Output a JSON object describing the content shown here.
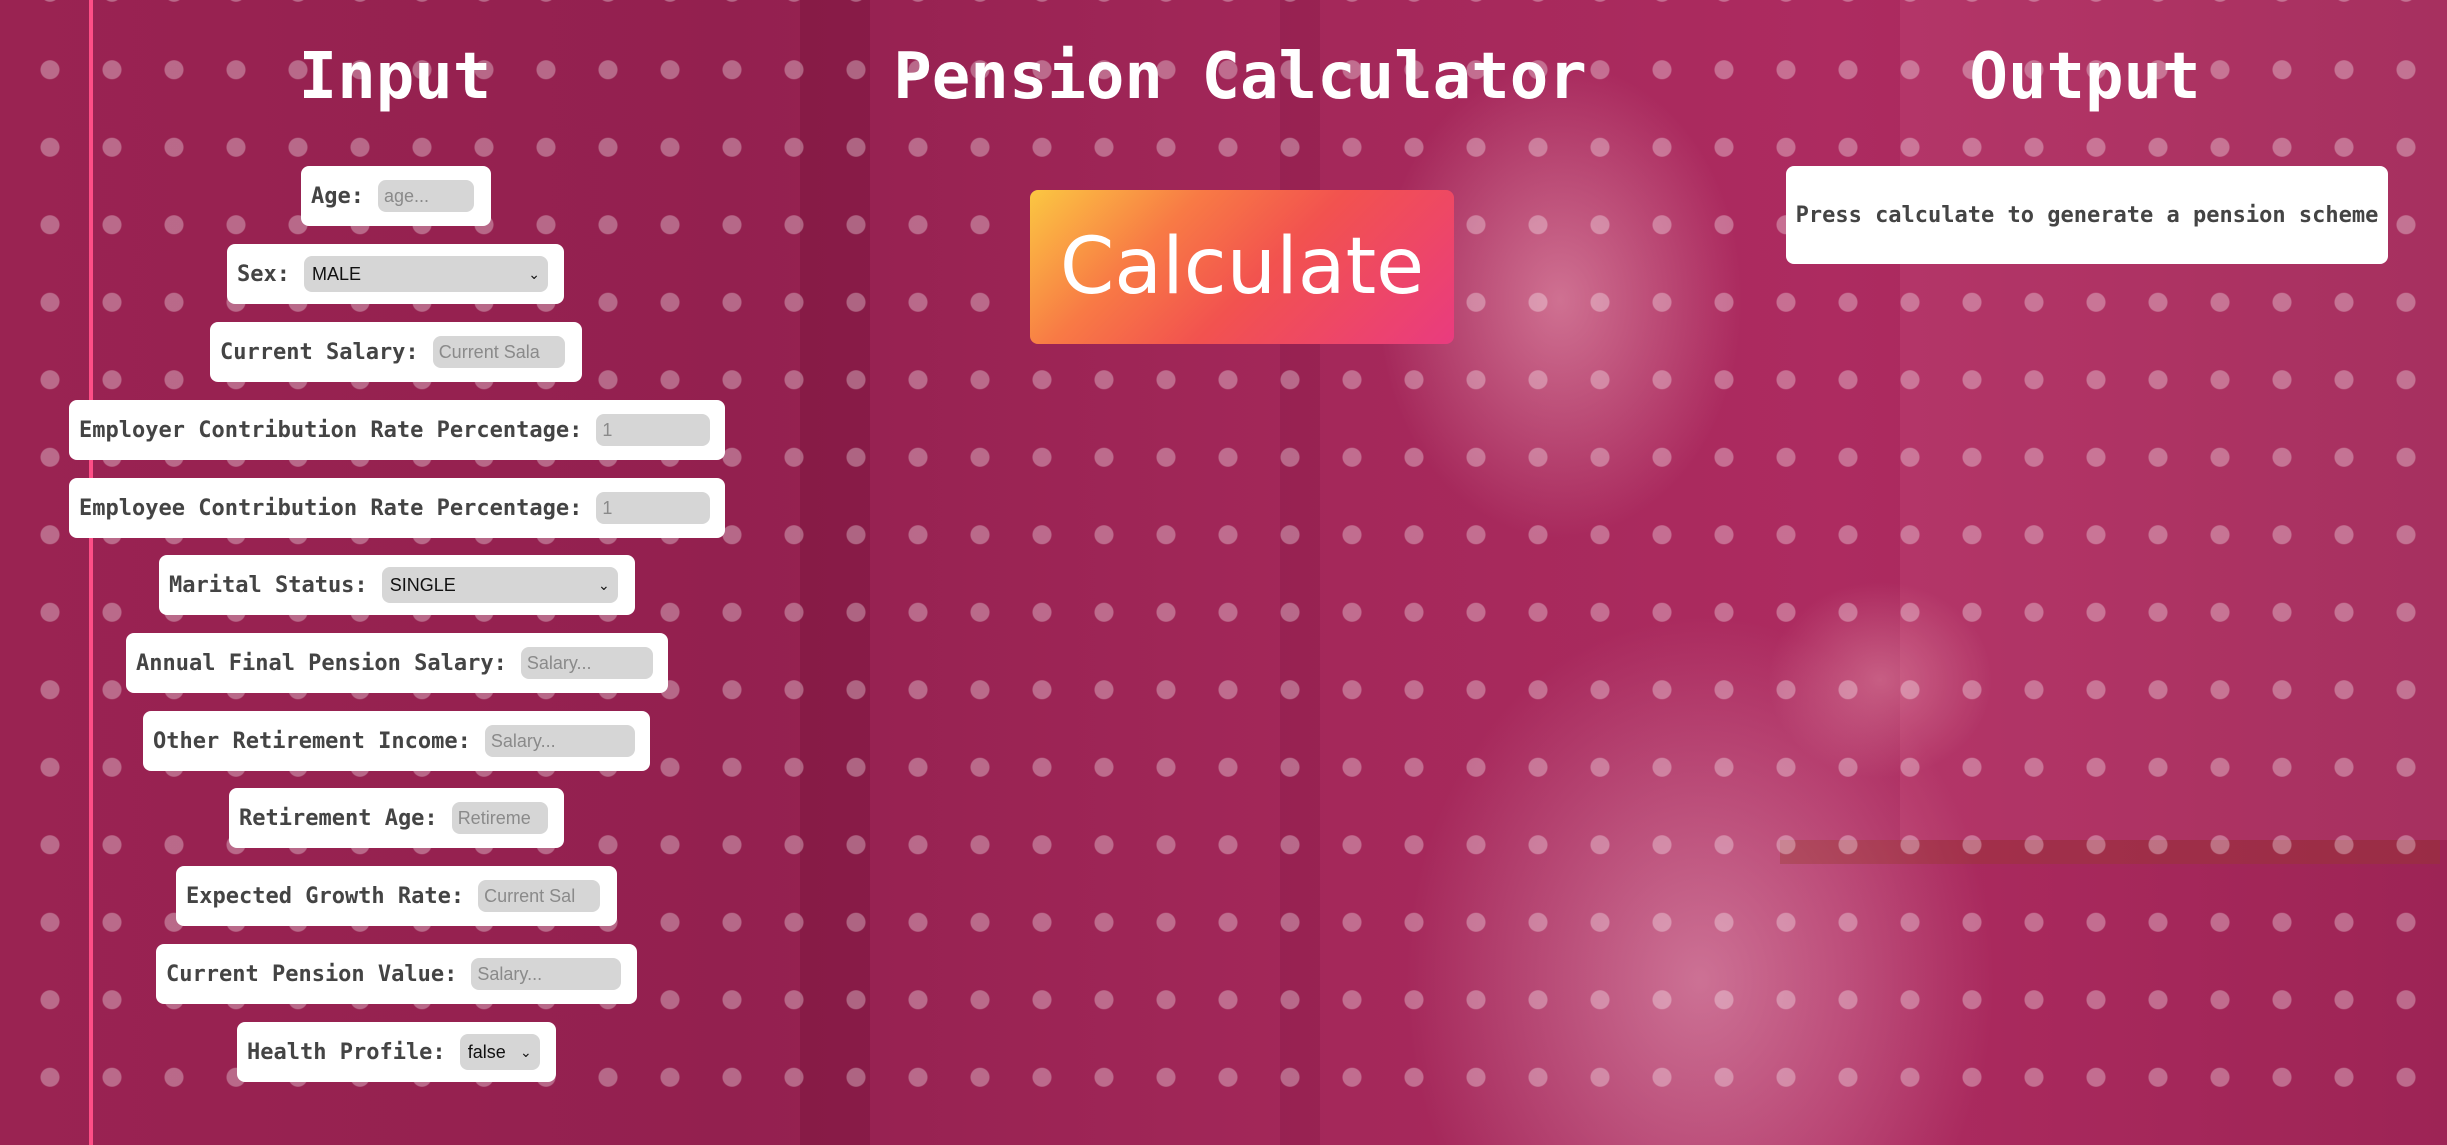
{
  "headings": {
    "input": "Input",
    "title": "Pension Calculator",
    "output": "Output"
  },
  "form": {
    "age": {
      "label": "Age:",
      "placeholder": "age..."
    },
    "sex": {
      "label": "Sex:",
      "value": "MALE"
    },
    "current_salary": {
      "label": "Current Salary:",
      "placeholder": "Current Sala"
    },
    "employer_rate": {
      "label": "Employer Contribution Rate Percentage:",
      "placeholder": "1"
    },
    "employee_rate": {
      "label": "Employee Contribution Rate Percentage:",
      "placeholder": "1"
    },
    "marital_status": {
      "label": "Marital Status:",
      "value": "SINGLE"
    },
    "final_salary": {
      "label": "Annual Final Pension Salary:",
      "placeholder": "Salary..."
    },
    "other_income": {
      "label": "Other Retirement Income:",
      "placeholder": "Salary..."
    },
    "retirement_age": {
      "label": "Retirement Age:",
      "placeholder": "Retireme"
    },
    "growth_rate": {
      "label": "Expected Growth Rate:",
      "placeholder": "Current Sal"
    },
    "pension_value": {
      "label": "Current Pension Value:",
      "placeholder": "Salary..."
    },
    "health_profile": {
      "label": "Health Profile:",
      "value": "false"
    }
  },
  "calculate_label": "Calculate",
  "output_text": "Press calculate to generate a pension scheme",
  "icons": {
    "dropdown": "chevron-down-icon"
  },
  "colors": {
    "accent_line": "#ff4e86",
    "background": "#8e1f4c"
  }
}
